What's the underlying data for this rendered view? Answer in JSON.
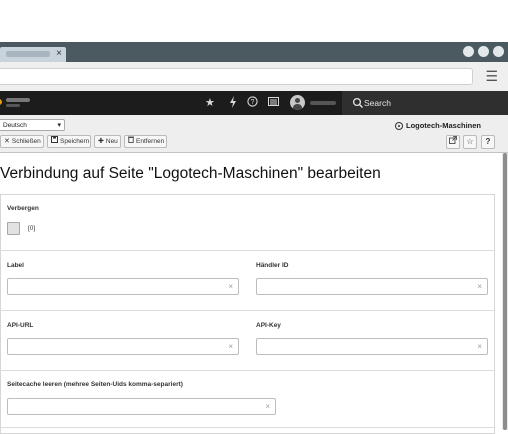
{
  "browser": {
    "tab_close": "×",
    "menu_icon": "☰"
  },
  "topbar": {
    "search_label": "Search",
    "icons": [
      "star-icon",
      "bolt-icon",
      "help-icon",
      "list-icon",
      "user-avatar-icon",
      "search-icon"
    ]
  },
  "docheader": {
    "language_select": {
      "selected": "Deutsch"
    },
    "buttons": {
      "close": "Schließen",
      "save": "Speichern",
      "new": "Neu",
      "delete": "Entfernen"
    },
    "page_title": "Logotech-Maschinen"
  },
  "content": {
    "heading": "Verbindung auf Seite \"Logotech-Maschinen\" bearbeiten",
    "hide": {
      "label": "Verbergen",
      "value": "[0]"
    },
    "fields": {
      "label": {
        "label": "Label",
        "value": ""
      },
      "dealer_id": {
        "label": "Händler ID",
        "value": ""
      },
      "api_url": {
        "label": "API-URL",
        "value": ""
      },
      "api_key": {
        "label": "API-Key",
        "value": ""
      },
      "cache_clear": {
        "label": "Seitecache leeren (mehree Seiten-Uids komma-separiert)",
        "value": ""
      }
    },
    "clear_glyph": "×"
  },
  "colors": {
    "topbar_bg": "#1c1c1c",
    "accent_logo": "#f49700",
    "docheader_bg": "#eeeeee",
    "browser_tabbar": "#4a5a60"
  }
}
